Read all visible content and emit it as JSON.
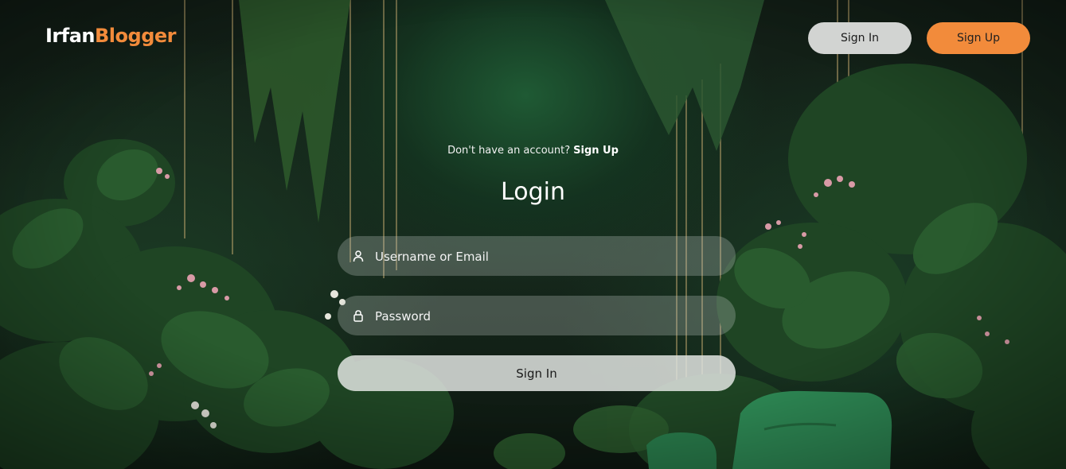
{
  "brand": {
    "part1": "Irfan",
    "part2": "Blogger"
  },
  "nav": {
    "signin_label": "Sign In",
    "signup_label": "Sign Up"
  },
  "form": {
    "switch_text": "Don't have an account?",
    "switch_link": "Sign Up",
    "title": "Login",
    "username_placeholder": "Username or Email",
    "username_icon": "user-icon",
    "password_placeholder": "Password",
    "password_icon": "lock-icon",
    "submit_label": "Sign In"
  },
  "colors": {
    "accent": "#f28b3b",
    "secondary_button": "#d2d4d2",
    "background": "#16281c"
  }
}
